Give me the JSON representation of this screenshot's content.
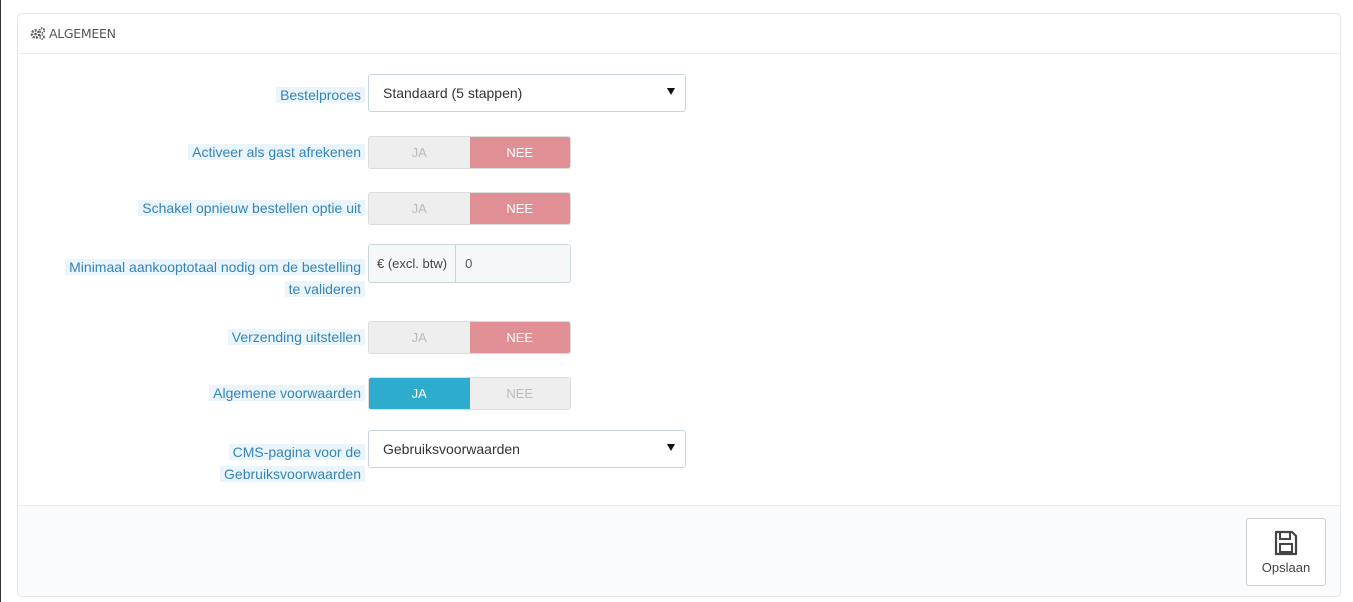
{
  "panel": {
    "title": "ALGEMEEN",
    "heading_icon": "cogs-icon"
  },
  "fields": {
    "order_process": {
      "label": "Bestelproces",
      "value": "Standaard (5 stappen)"
    },
    "guest_checkout": {
      "label": "Activeer als gast afrekenen",
      "yes": "JA",
      "no": "NEE",
      "selected": "NEE"
    },
    "reorder_option": {
      "label": "Schakel opnieuw bestellen optie uit",
      "yes": "JA",
      "no": "NEE",
      "selected": "NEE"
    },
    "min_purchase": {
      "label": "Minimaal aankooptotaal nodig om de bestelling te valideren",
      "addon": "€ (excl. btw)",
      "value": "0"
    },
    "delay_shipping": {
      "label": "Verzending uitstellen",
      "yes": "JA",
      "no": "NEE",
      "selected": "NEE"
    },
    "terms": {
      "label": "Algemene voorwaarden",
      "yes": "JA",
      "no": "NEE",
      "selected": "JA"
    },
    "cms_page": {
      "label": "CMS-pagina voor de Gebruiksvoorwaarden",
      "value": "Gebruiksvoorwaarden"
    }
  },
  "footer": {
    "save_label": "Opslaan",
    "save_icon": "save-icon"
  },
  "colors": {
    "label_bg": "#eaf5fb",
    "label_text": "#3584b6",
    "switch_no_active": "#e08f95",
    "switch_yes_active": "#2eacce"
  }
}
